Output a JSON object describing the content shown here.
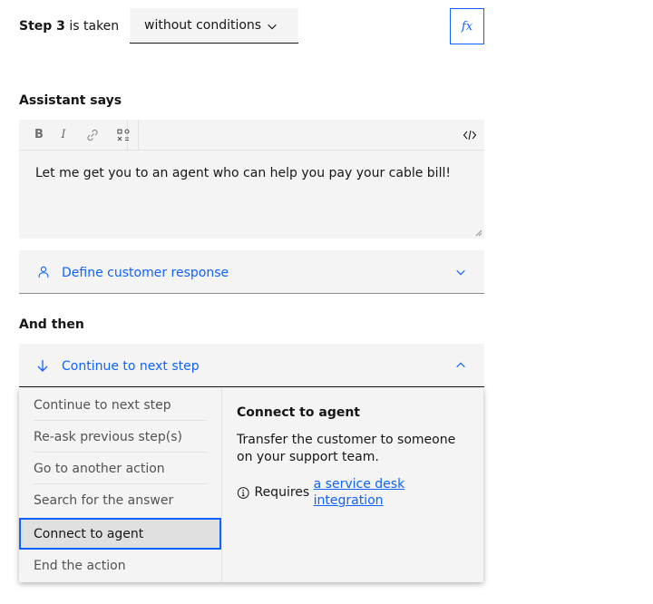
{
  "step": {
    "label_bold": "Step 3",
    "label_rest": " is taken",
    "condition_value": "without conditions",
    "fx_label": "fx"
  },
  "assistant": {
    "title": "Assistant says",
    "message": "Let me get you to an agent who can help you pay your cable bill!",
    "toolbar": {
      "bold": "B",
      "italic": "I"
    }
  },
  "customer_response": {
    "label": "Define customer response"
  },
  "and_then": {
    "title": "And then",
    "selected_value": "Continue to next step",
    "options": [
      "Continue to next step",
      "Re-ask previous step(s)",
      "Go to another action",
      "Search for the answer",
      "Connect to agent",
      "End the action"
    ],
    "highlighted_index": 4,
    "detail": {
      "title": "Connect to agent",
      "description": "Transfer the customer to someone on your support team.",
      "requires_prefix": "Requires ",
      "requires_link": "a service desk integration"
    }
  },
  "colors": {
    "accent": "#0f62fe",
    "field_bg": "#f4f4f4",
    "text": "#161616"
  }
}
